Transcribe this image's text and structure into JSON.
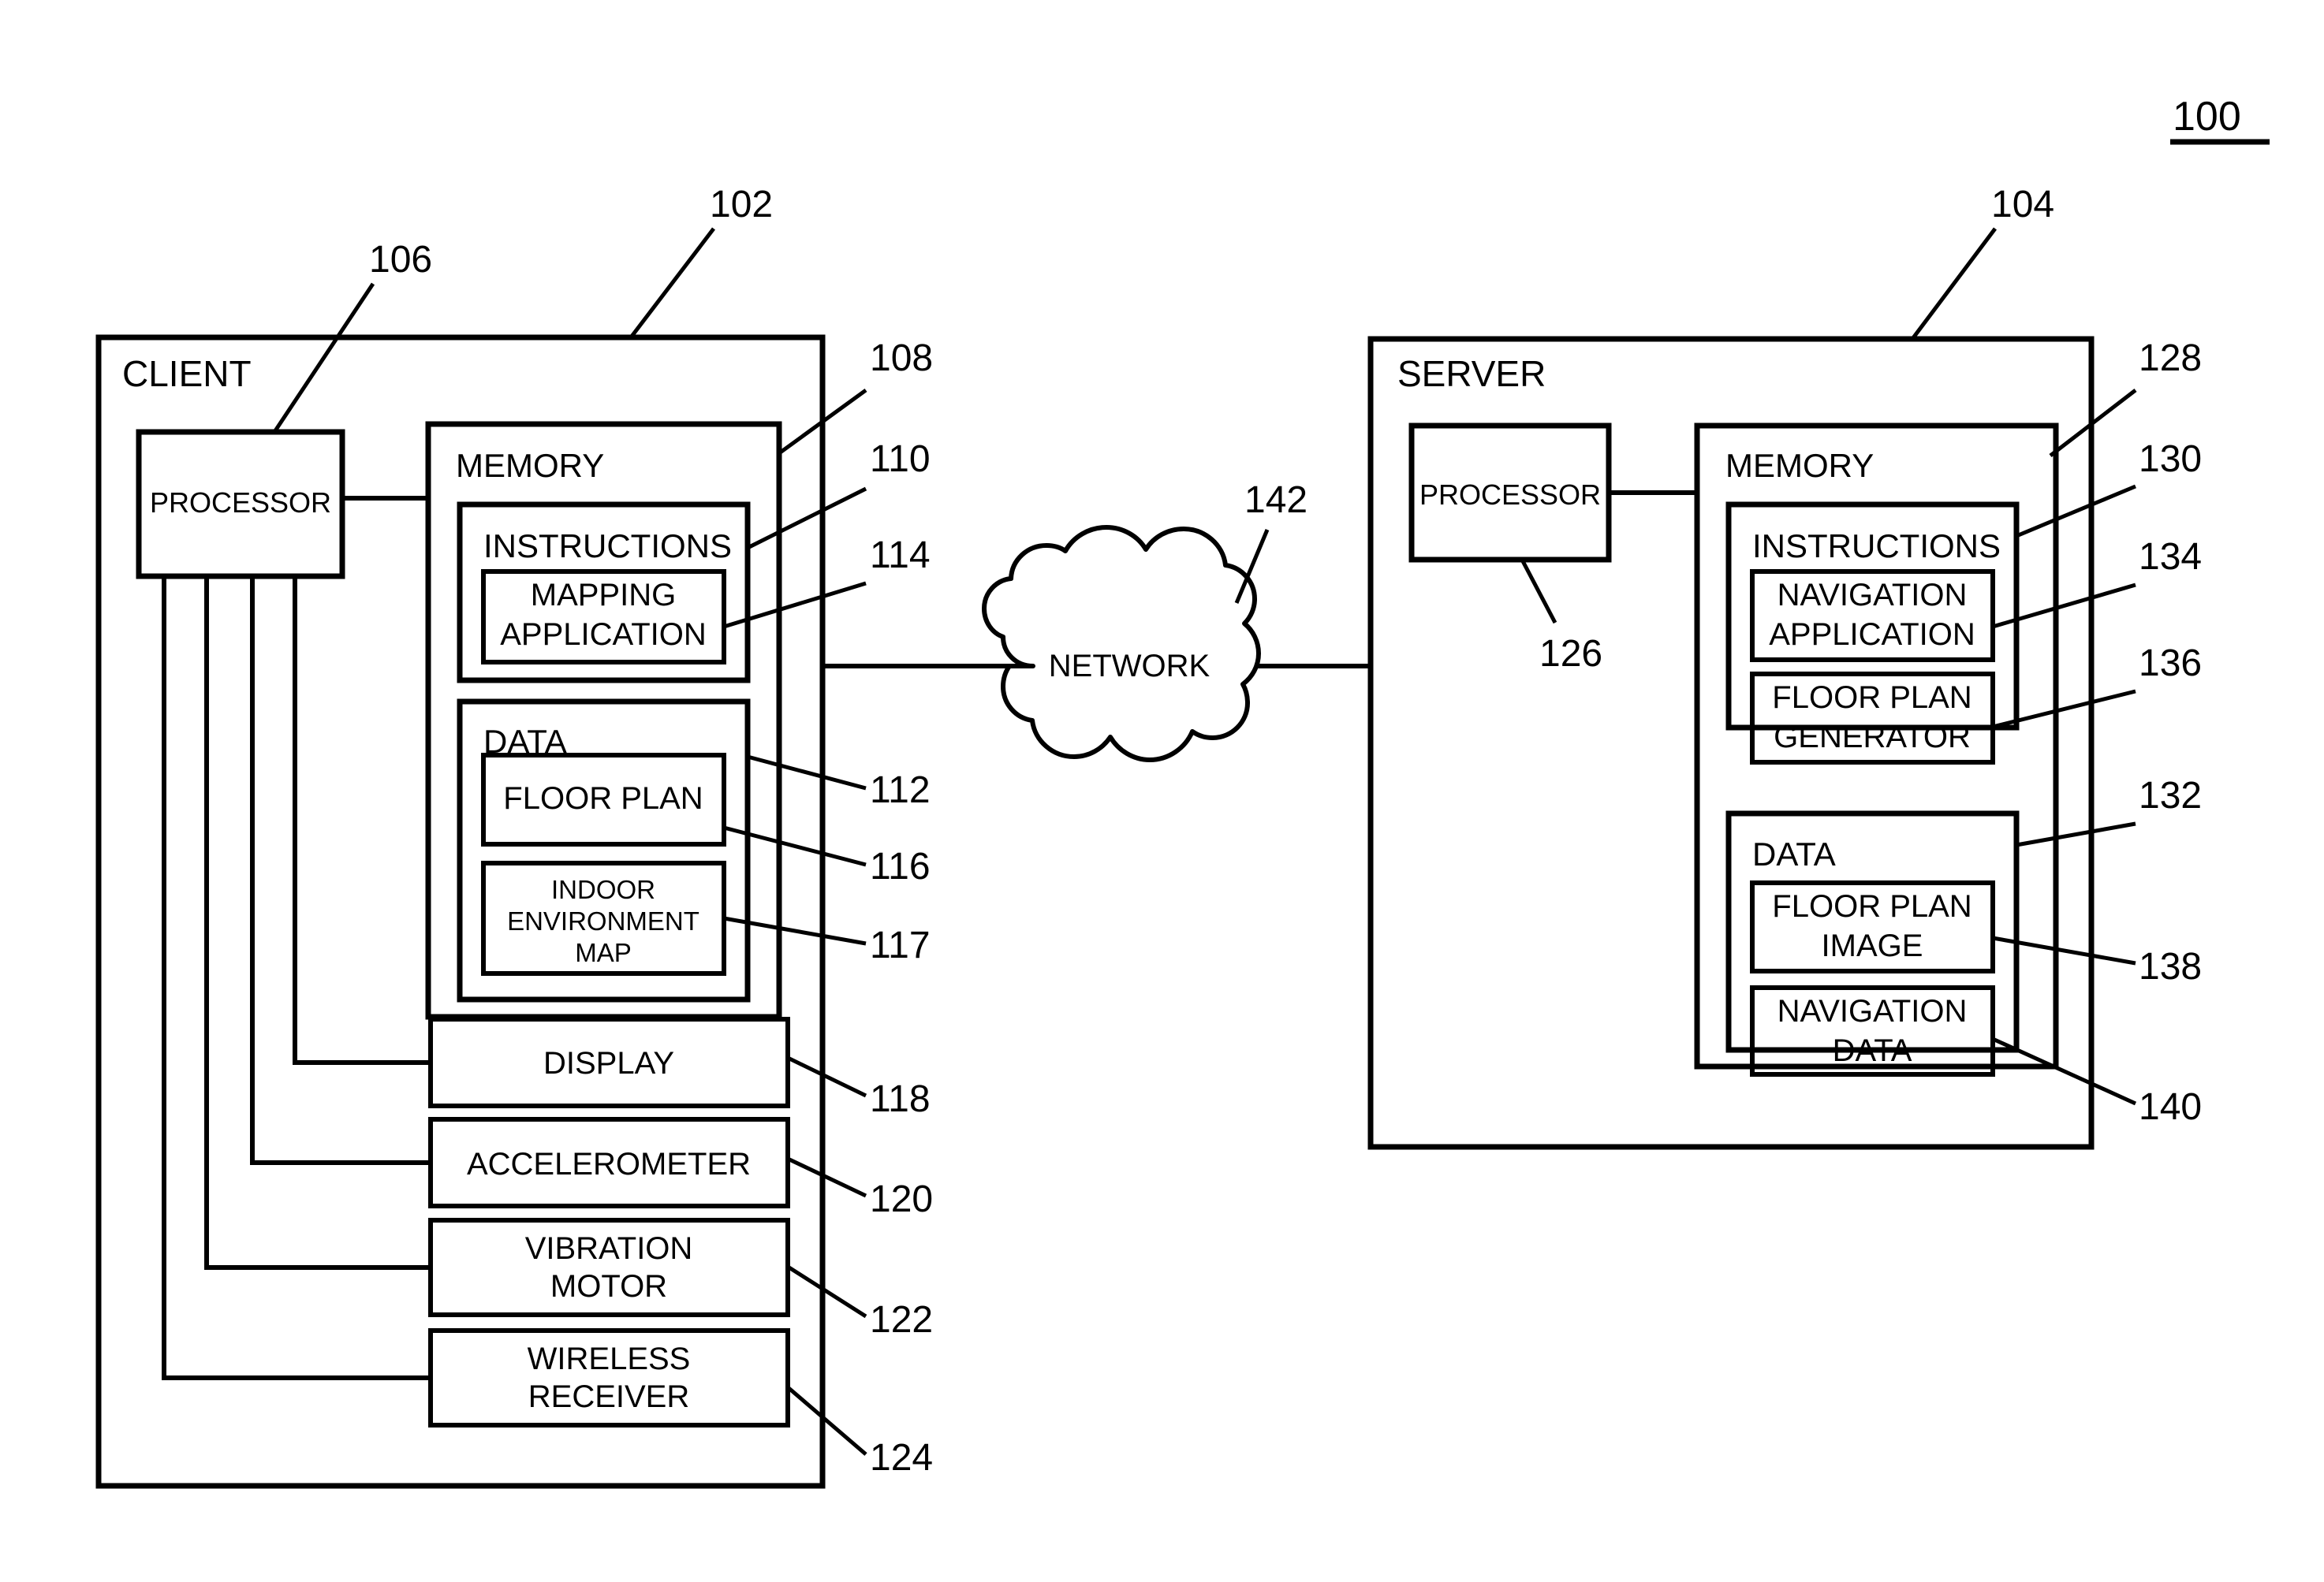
{
  "figure": {
    "number": "100",
    "underlined": true
  },
  "client": {
    "title": "CLIENT",
    "ref": "102",
    "processor": {
      "label": "PROCESSOR",
      "ref": "106"
    },
    "memory": {
      "label": "MEMORY",
      "ref": "108",
      "instructions": {
        "label": "INSTRUCTIONS",
        "ref": "110",
        "items": [
          {
            "label": "MAPPING\nAPPLICATION",
            "line1": "MAPPING",
            "line2": "APPLICATION",
            "ref": "114"
          }
        ]
      },
      "data": {
        "label": "DATA",
        "ref": "112",
        "items": [
          {
            "line1": "FLOOR PLAN",
            "line2": "",
            "line3": "",
            "ref": "116",
            "small": false
          },
          {
            "line1": "INDOOR",
            "line2": "ENVIRONMENT",
            "line3": "MAP",
            "ref": "117",
            "small": true
          }
        ]
      }
    },
    "peripherals": [
      {
        "line1": "DISPLAY",
        "line2": "",
        "ref": "118"
      },
      {
        "line1": "ACCELEROMETER",
        "line2": "",
        "ref": "120"
      },
      {
        "line1": "VIBRATION",
        "line2": "MOTOR",
        "ref": "122"
      },
      {
        "line1": "WIRELESS",
        "line2": "RECEIVER",
        "ref": "124"
      }
    ]
  },
  "network": {
    "label": "NETWORK",
    "ref": "142"
  },
  "server": {
    "title": "SERVER",
    "ref": "104",
    "processor": {
      "label": "PROCESSOR",
      "ref": "126"
    },
    "memory": {
      "label": "MEMORY",
      "ref": "128",
      "instructions": {
        "label": "INSTRUCTIONS",
        "ref": "130",
        "items": [
          {
            "line1": "NAVIGATION",
            "line2": "APPLICATION",
            "ref": "134"
          },
          {
            "line1": "FLOOR PLAN",
            "line2": "GENERATOR",
            "ref": "136"
          }
        ]
      },
      "data": {
        "label": "DATA",
        "ref": "132",
        "items": [
          {
            "line1": "FLOOR PLAN",
            "line2": "IMAGE",
            "ref": "138"
          },
          {
            "line1": "NAVIGATION",
            "line2": "DATA",
            "ref": "140"
          }
        ]
      }
    }
  },
  "colors": {
    "ink": "#000000",
    "paper": "#ffffff"
  }
}
